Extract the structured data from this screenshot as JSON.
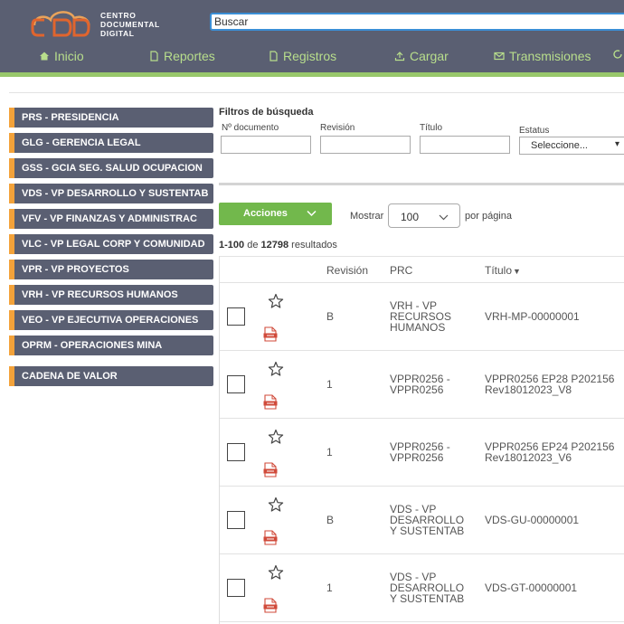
{
  "header": {
    "logo_lines": [
      "CENTRO",
      "DOCUMENTAL",
      "DIGITAL"
    ],
    "search_placeholder": "Buscar",
    "nav": [
      {
        "label": "Inicio",
        "icon": "home-icon"
      },
      {
        "label": "Reportes",
        "icon": "document-icon"
      },
      {
        "label": "Registros",
        "icon": "document-icon"
      },
      {
        "label": "Cargar",
        "icon": "upload-icon"
      },
      {
        "label": "Transmisiones",
        "icon": "mail-icon"
      }
    ],
    "accent_color": "#98c86b",
    "bg_color": "#5a5f72"
  },
  "sidebar": {
    "items": [
      {
        "label": "PRS - PRESIDENCIA"
      },
      {
        "label": "GLG - GERENCIA LEGAL"
      },
      {
        "label": "GSS - GCIA SEG. SALUD OCUPACION"
      },
      {
        "label": "VDS - VP DESARROLLO Y SUSTENTAB"
      },
      {
        "label": "VFV - VP FINANZAS Y ADMINISTRAC"
      },
      {
        "label": "VLC - VP LEGAL CORP Y COMUNIDAD"
      },
      {
        "label": "VPR - VP PROYECTOS"
      },
      {
        "label": "VRH - VP RECURSOS HUMANOS"
      },
      {
        "label": "VEO - VP EJECUTIVA OPERACIONES"
      },
      {
        "label": "OPRM - OPERACIONES MINA"
      },
      {
        "label": "CADENA DE VALOR"
      }
    ],
    "marker_color": "#f3a23a"
  },
  "filters": {
    "title": "Filtros de búsqueda",
    "fields": [
      {
        "label": "Nº documento",
        "value": ""
      },
      {
        "label": "Revisión",
        "value": ""
      },
      {
        "label": "Título",
        "value": ""
      }
    ],
    "status": {
      "label": "Estatus",
      "value": "Seleccione..."
    }
  },
  "actions": {
    "acciones_label": "Acciones",
    "mostrar_label": "Mostrar",
    "page_size": "100",
    "por_pagina_label": "por página",
    "results_range": "1-100",
    "results_de": "de",
    "results_total": "12798",
    "results_suffix": "resultados"
  },
  "table": {
    "headers": {
      "revision": "Revisión",
      "prc": "PRC",
      "titulo": "Título"
    },
    "sort_column": "titulo",
    "sort_direction": "descending",
    "rows": [
      {
        "revision": "B",
        "prc": [
          "VRH - VP",
          "RECURSOS",
          "HUMANOS"
        ],
        "titulo": [
          "VRH-MP-00000001"
        ]
      },
      {
        "revision": "1",
        "prc": [
          "VPPR0256 -",
          "VPPR0256"
        ],
        "titulo": [
          "VPPR0256 EP28 P202156",
          "Rev18012023_V8"
        ]
      },
      {
        "revision": "1",
        "prc": [
          "VPPR0256 -",
          "VPPR0256"
        ],
        "titulo": [
          "VPPR0256 EP24 P202156",
          "Rev18012023_V6"
        ]
      },
      {
        "revision": "B",
        "prc": [
          "VDS - VP",
          "DESARROLLO",
          "Y SUSTENTAB"
        ],
        "titulo": [
          "VDS-GU-00000001"
        ]
      },
      {
        "revision": "1",
        "prc": [
          "VDS - VP",
          "DESARROLLO",
          "Y SUSTENTAB"
        ],
        "titulo": [
          "VDS-GT-00000001"
        ]
      }
    ]
  }
}
